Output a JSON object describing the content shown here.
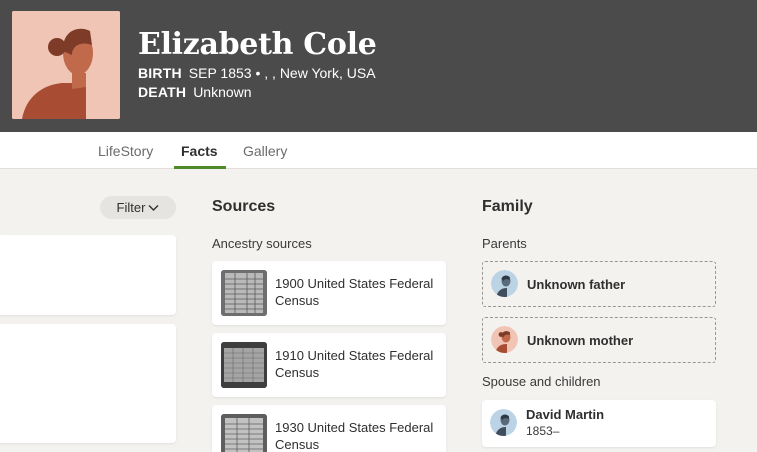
{
  "profile": {
    "name": "Elizabeth Cole",
    "birth_label": "BIRTH",
    "birth_value": "SEP 1853 • , , New York, USA",
    "death_label": "DEATH",
    "death_value": "Unknown"
  },
  "tabs": [
    {
      "label": "LifeStory",
      "active": false
    },
    {
      "label": "Facts",
      "active": true
    },
    {
      "label": "Gallery",
      "active": false
    }
  ],
  "facts": {
    "filter_label": "Filter"
  },
  "sources": {
    "title": "Sources",
    "subtitle": "Ancestry sources",
    "items": [
      {
        "title": "1900 United States Federal Census"
      },
      {
        "title": "1910 United States Federal Census"
      },
      {
        "title": "1930 United States Federal Census"
      }
    ]
  },
  "family": {
    "title": "Family",
    "parents_label": "Parents",
    "father": "Unknown father",
    "mother": "Unknown mother",
    "spouse_label": "Spouse and children",
    "spouse": {
      "name": "David Martin",
      "years": "1853–"
    }
  },
  "colors": {
    "header_bg": "#4b4b4b",
    "tab_active_underline": "#4e8a2a",
    "page_bg": "#f4f2ef",
    "female_avatar_bg": "#f0c5b6",
    "male_avatar_bg": "#bcd3e6"
  }
}
